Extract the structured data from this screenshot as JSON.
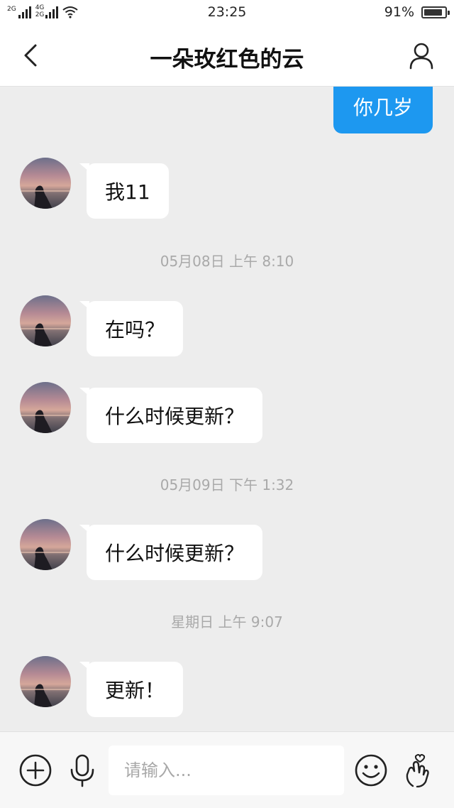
{
  "status_bar": {
    "net1": "2G",
    "net2_top": "4G",
    "net2_bottom": "2G",
    "time": "23:25",
    "battery": "91%",
    "battery_level": 0.91
  },
  "header": {
    "title": "一朵玫红色的云"
  },
  "messages": [
    {
      "direction": "out",
      "text": "你几岁"
    },
    {
      "direction": "in",
      "text": "我11"
    },
    {
      "type": "timestamp",
      "text": "05月08日 上午 8:10"
    },
    {
      "direction": "in",
      "text": "在吗？"
    },
    {
      "direction": "in",
      "text": "什么时候更新？"
    },
    {
      "type": "timestamp",
      "text": "05月09日 下午 1:32"
    },
    {
      "direction": "in",
      "text": "什么时候更新？"
    },
    {
      "type": "timestamp",
      "text": "星期日 上午 9:07"
    },
    {
      "direction": "in",
      "text": "更新！"
    }
  ],
  "input_bar": {
    "placeholder": "请输入..."
  },
  "colors": {
    "outgoing_bubble": "#1d98f0",
    "chat_background": "#ededed",
    "timestamp_text": "#a9a9a9"
  },
  "icons": {
    "back": "chevron-left-icon",
    "profile": "person-icon",
    "add": "plus-circle-icon",
    "voice": "microphone-icon",
    "emoji": "smiley-icon",
    "gesture": "finger-heart-hand-icon"
  }
}
